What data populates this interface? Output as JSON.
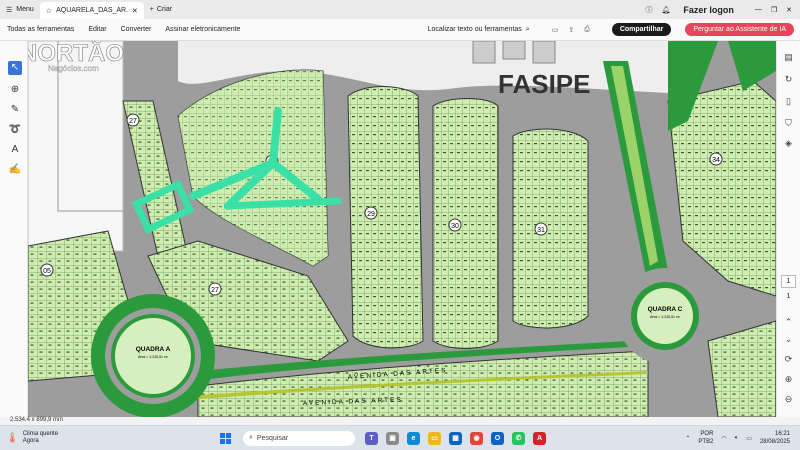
{
  "titlebar": {
    "menu_label": "Menu",
    "tab_title": "AQUARELA_DAS_AR...",
    "new_tab_label": "Criar",
    "login_label": "Fazer logon"
  },
  "toolbar": {
    "all_tools": "Todas as ferramentas",
    "edit": "Editar",
    "convert": "Converter",
    "sign": "Assinar eletronicamente",
    "search_label": "Localizar texto ou ferramentas",
    "share_label": "Compartilhar",
    "ai_label": "Perguntar ao Assistente de IA"
  },
  "watermark": {
    "brand": "NORTÃO",
    "sub": "Negócios.com"
  },
  "map": {
    "title": "FASIPE",
    "quadra_a": "QUADRA A",
    "quadra_a_sub": "Área = 1.226,51 m²",
    "quadra_c": "QUADRA C",
    "quadra_c_sub": "Área = 1.226,51 m²",
    "avenue_1": "AVENIDA DAS ARTES",
    "avenue_2": "AVENIDA DAS ARTES",
    "blocks": [
      "27",
      "28",
      "29",
      "30",
      "31",
      "34",
      "05",
      "27"
    ]
  },
  "right_panel": {
    "page_current": "1",
    "page_total": "1"
  },
  "status": {
    "dimensions": "2.534,4 x 899,9 mm"
  },
  "taskbar": {
    "weather_title": "Clima quente",
    "weather_sub": "Agora",
    "search_placeholder": "Pesquisar",
    "lang_1": "POR",
    "lang_2": "PTB2",
    "time": "16:21",
    "date": "28/08/2025"
  },
  "colors": {
    "lot_green": "#cdeeb0",
    "park_green": "#2a9a3c",
    "road_gray": "#9d9d9d",
    "accent_blue": "#3a73d6",
    "ai_red": "#e8455a"
  }
}
